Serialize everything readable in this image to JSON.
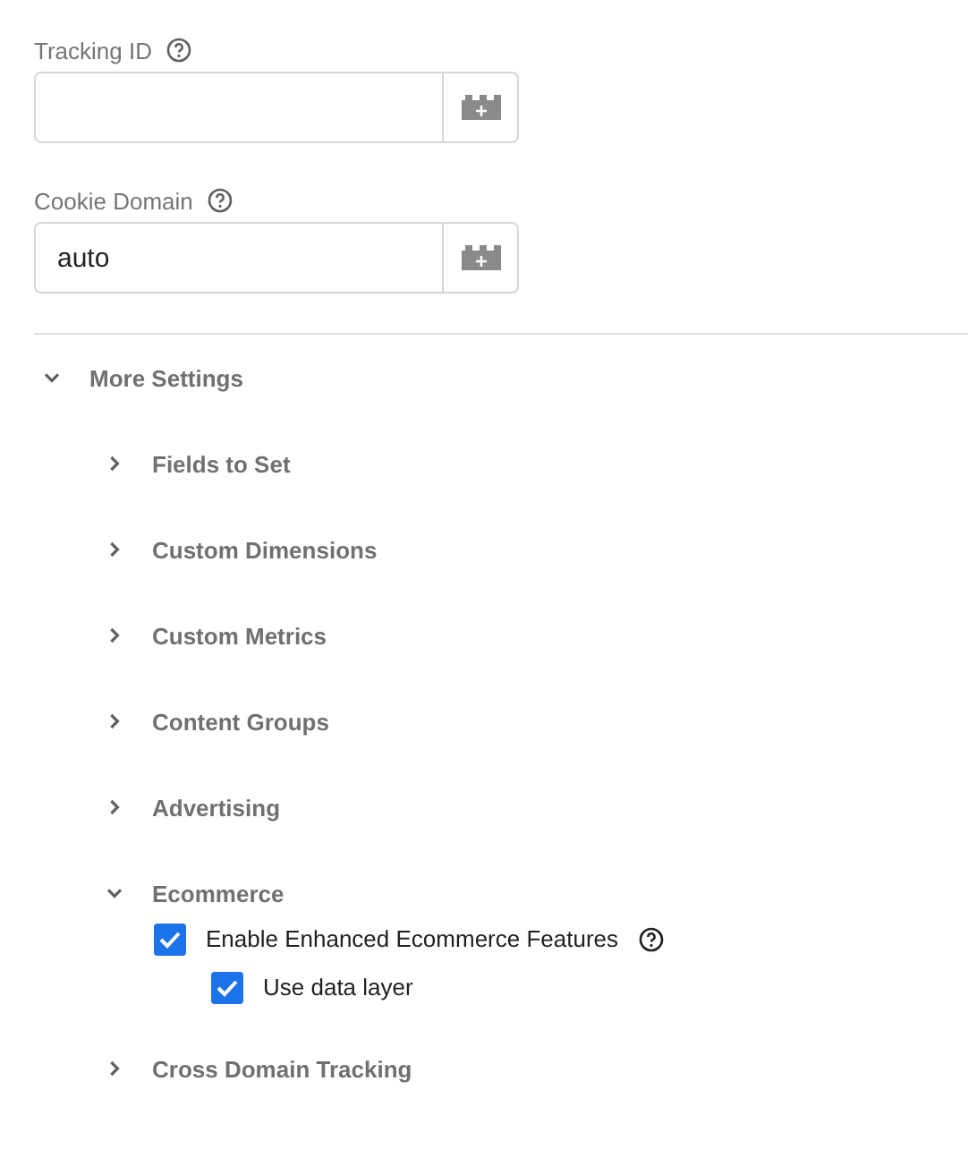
{
  "fields": [
    {
      "label": "Tracking ID",
      "help": true
    },
    {
      "label": "Cookie Domain",
      "help": true,
      "value": "auto"
    }
  ],
  "more_settings": {
    "label": "More Settings",
    "expanded": true,
    "sections": [
      {
        "label": "Fields to Set",
        "expanded": false
      },
      {
        "label": "Custom Dimensions",
        "expanded": false
      },
      {
        "label": "Custom Metrics",
        "expanded": false
      },
      {
        "label": "Content Groups",
        "expanded": false
      },
      {
        "label": "Advertising",
        "expanded": false
      },
      {
        "label": "Ecommerce",
        "expanded": true,
        "options": [
          {
            "label": "Enable Enhanced Ecommerce Features",
            "checked": true,
            "help": true,
            "children": [
              {
                "label": "Use data layer",
                "checked": true,
                "help": false
              }
            ]
          }
        ]
      },
      {
        "label": "Cross Domain Tracking",
        "expanded": false
      }
    ]
  }
}
